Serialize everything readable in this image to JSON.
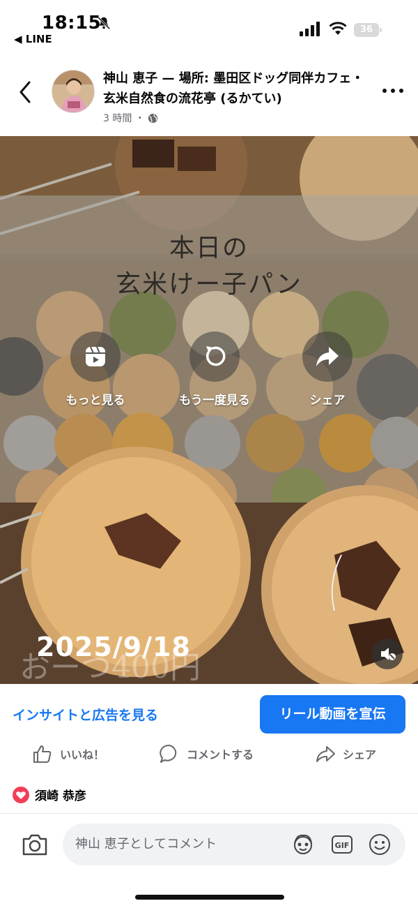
{
  "status_bar": {
    "time": "18:15",
    "back_app": "◀ LINE",
    "battery": "36"
  },
  "header": {
    "title": "神山 恵子 — 場所: 墨田区ドッグ同伴カフェ・玄米自然食の流花亭 (るかてい)",
    "meta": "3 時間 ・"
  },
  "video": {
    "overlay_title_line1": "本日の",
    "overlay_title_line2": "玄米けー子パン",
    "actions": [
      {
        "label": "もっと見る",
        "icon": "reels-icon"
      },
      {
        "label": "もう一度見る",
        "icon": "replay-icon"
      },
      {
        "label": "シェア",
        "icon": "share-arrow-icon"
      }
    ],
    "date_overlay": "2025/9/18",
    "faint_text": "おーつ400円"
  },
  "post_actions": {
    "insight_link": "インサイトと広告を見る",
    "promote_button": "リール動画を宣伝",
    "like": "いいね！",
    "comment": "コメントする",
    "share": "シェア"
  },
  "reactions": {
    "liker_name": "須崎 恭彦"
  },
  "comment_bar": {
    "placeholder": "神山 恵子としてコメント"
  },
  "colors": {
    "accent": "#1877f2",
    "heart": "#f33e58"
  }
}
